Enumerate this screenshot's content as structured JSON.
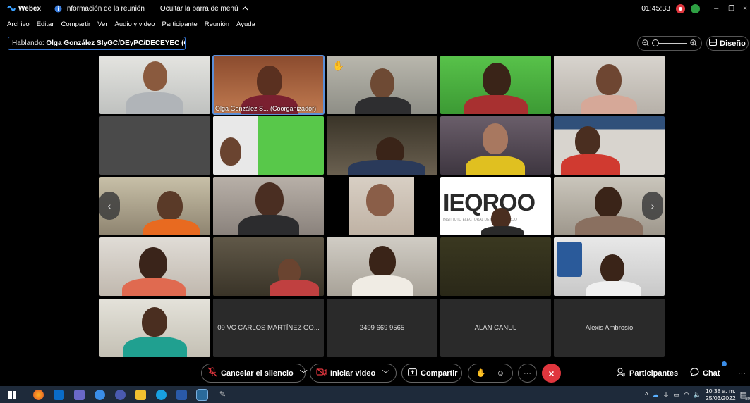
{
  "titlebar": {
    "app_name": "Webex",
    "meeting_info": "Información de la reunión",
    "hide_menu": "Ocultar la barra de menú",
    "timer": "01:45:33"
  },
  "menu": [
    "Archivo",
    "Editar",
    "Compartir",
    "Ver",
    "Audio y video",
    "Participante",
    "Reunión",
    "Ayuda"
  ],
  "speaking": {
    "prefix": "Hablando:",
    "name": "Olga González SIyGC/DEyPC/DECEYEC (C..."
  },
  "layout_label": "Diseño",
  "tiles": {
    "host_label": "Olga González S... (Coorganizador)",
    "logo_text": "IEQROO",
    "logo_sub": "INSTITUTO ELECTORAL DE QUINTANA ROO",
    "name1": "09 VC CARLOS MARTÍNEZ GO...",
    "name2": "2499 669 9565",
    "name3": "ALAN CANUL",
    "name4": "Alexis Ambrosio"
  },
  "controls": {
    "mute": "Cancelar el silencio",
    "video": "Iniciar video",
    "share": "Compartir",
    "participants": "Participantes",
    "chat": "Chat"
  },
  "taskbar": {
    "time": "10:38 a. m.",
    "date": "25/03/2022",
    "notif_count": "20"
  },
  "colors": {
    "accent_blue": "#3a7dde",
    "end_call_red": "#e0363e"
  }
}
